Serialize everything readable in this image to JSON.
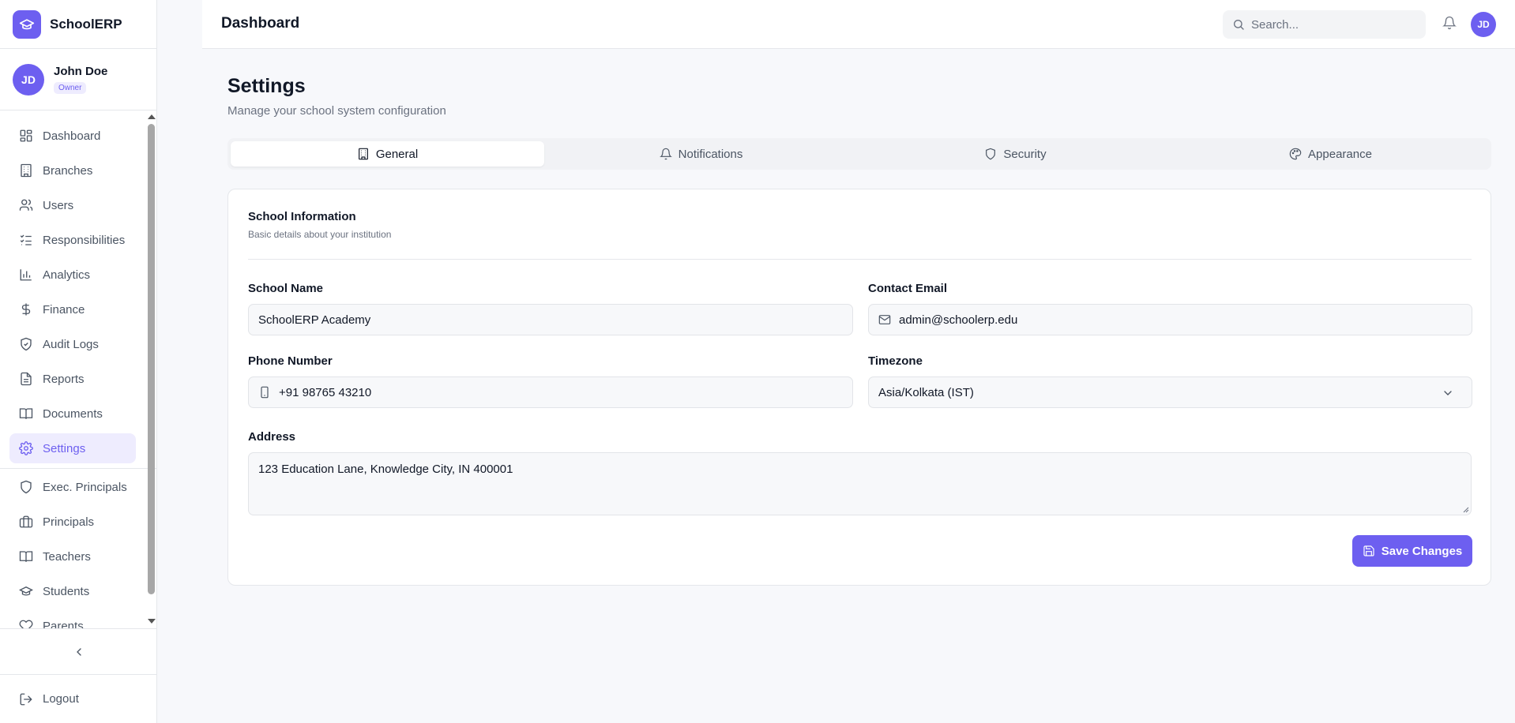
{
  "app": {
    "name": "SchoolERP"
  },
  "user": {
    "initials": "JD",
    "name": "John Doe",
    "role": "Owner"
  },
  "sidebar": {
    "items": [
      {
        "label": "Dashboard",
        "icon": "grid-icon"
      },
      {
        "label": "Branches",
        "icon": "building-icon"
      },
      {
        "label": "Users",
        "icon": "users-icon"
      },
      {
        "label": "Responsibilities",
        "icon": "checklist-icon"
      },
      {
        "label": "Analytics",
        "icon": "bar-chart-icon"
      },
      {
        "label": "Finance",
        "icon": "dollar-icon"
      },
      {
        "label": "Audit Logs",
        "icon": "shield-check-icon"
      },
      {
        "label": "Reports",
        "icon": "file-text-icon"
      },
      {
        "label": "Documents",
        "icon": "book-open-icon"
      },
      {
        "label": "Settings",
        "icon": "gear-icon",
        "active": true
      }
    ],
    "items2": [
      {
        "label": "Exec. Principals",
        "icon": "shield-icon"
      },
      {
        "label": "Principals",
        "icon": "briefcase-icon"
      },
      {
        "label": "Teachers",
        "icon": "book-open-icon"
      },
      {
        "label": "Students",
        "icon": "graduation-cap-icon"
      },
      {
        "label": "Parents",
        "icon": "heart-icon"
      }
    ],
    "logout": "Logout"
  },
  "header": {
    "title": "Dashboard",
    "search_placeholder": "Search...",
    "avatar_initials": "JD"
  },
  "page": {
    "title": "Settings",
    "subtitle": "Manage your school system configuration"
  },
  "tabs": [
    {
      "label": "General",
      "icon": "building-icon",
      "active": true
    },
    {
      "label": "Notifications",
      "icon": "bell-icon"
    },
    {
      "label": "Security",
      "icon": "shield-icon"
    },
    {
      "label": "Appearance",
      "icon": "palette-icon"
    }
  ],
  "form": {
    "section_title": "School Information",
    "section_subtitle": "Basic details about your institution",
    "school_name_label": "School Name",
    "school_name": "SchoolERP Academy",
    "email_label": "Contact Email",
    "email": "admin@schoolerp.edu",
    "phone_label": "Phone Number",
    "phone": "+91 98765 43210",
    "timezone_label": "Timezone",
    "timezone": "Asia/Kolkata (IST)",
    "address_label": "Address",
    "address": "123 Education Lane, Knowledge City, IN 400001",
    "save_label": "Save Changes"
  },
  "colors": {
    "accent": "#6d5ff0",
    "accent_soft": "#eeecfe"
  }
}
